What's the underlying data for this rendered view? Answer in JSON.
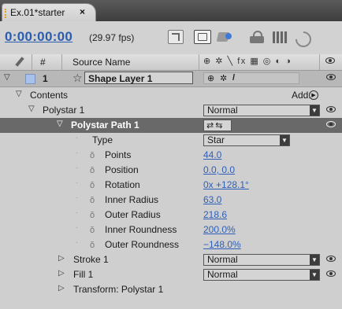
{
  "tab": {
    "label": "Ex.01*starter",
    "close": "×"
  },
  "toolbar": {
    "timecode": "0:00:00:00",
    "fps": "(29.97 fps)"
  },
  "columns": {
    "number": "#",
    "source_name": "Source Name",
    "switch_glyphs": "⊕ ✲ ╲ fx ▦ ◎ ◐ ◑"
  },
  "layer": {
    "number": "1",
    "name": "Shape Layer 1",
    "star": "☆",
    "switches": [
      "⊕",
      "✲",
      "/"
    ]
  },
  "contents": {
    "label": "Contents",
    "add_label": "Add:",
    "add_icon": "▶"
  },
  "polystar": {
    "label": "Polystar 1",
    "blend": "Normal"
  },
  "path": {
    "label": "Polystar Path 1",
    "path_icons": "⇄⇆"
  },
  "properties": [
    {
      "name": "Type",
      "value": "Star",
      "stopwatch": false,
      "dropdown": true
    },
    {
      "name": "Points",
      "value": "44.0",
      "stopwatch": true
    },
    {
      "name": "Position",
      "value": "0.0, 0.0",
      "stopwatch": true
    },
    {
      "name": "Rotation",
      "value": "0x +128.1°",
      "stopwatch": true
    },
    {
      "name": "Inner Radius",
      "value": "63.0",
      "stopwatch": true
    },
    {
      "name": "Outer Radius",
      "value": "218.6",
      "stopwatch": true
    },
    {
      "name": "Inner Roundness",
      "value": "200.0%",
      "stopwatch": true
    },
    {
      "name": "Outer Roundness",
      "value": "−148.0%",
      "stopwatch": true
    }
  ],
  "stroke": {
    "label": "Stroke 1",
    "blend": "Normal"
  },
  "fill": {
    "label": "Fill 1",
    "blend": "Normal"
  },
  "transform": {
    "label": "Transform: Polystar 1"
  },
  "glyphs": {
    "stopwatch": "ŏ",
    "dot": "·",
    "twirl_open": "▽",
    "twirl_closed": "▷",
    "dropdown_arrow": "▼"
  },
  "colors": {
    "timecode": "#2a5db0",
    "value": "#2f5fb8",
    "selected_row": "#696969",
    "label_swatch": "#a8c2ec",
    "tab_accent": "#e7a21c"
  }
}
